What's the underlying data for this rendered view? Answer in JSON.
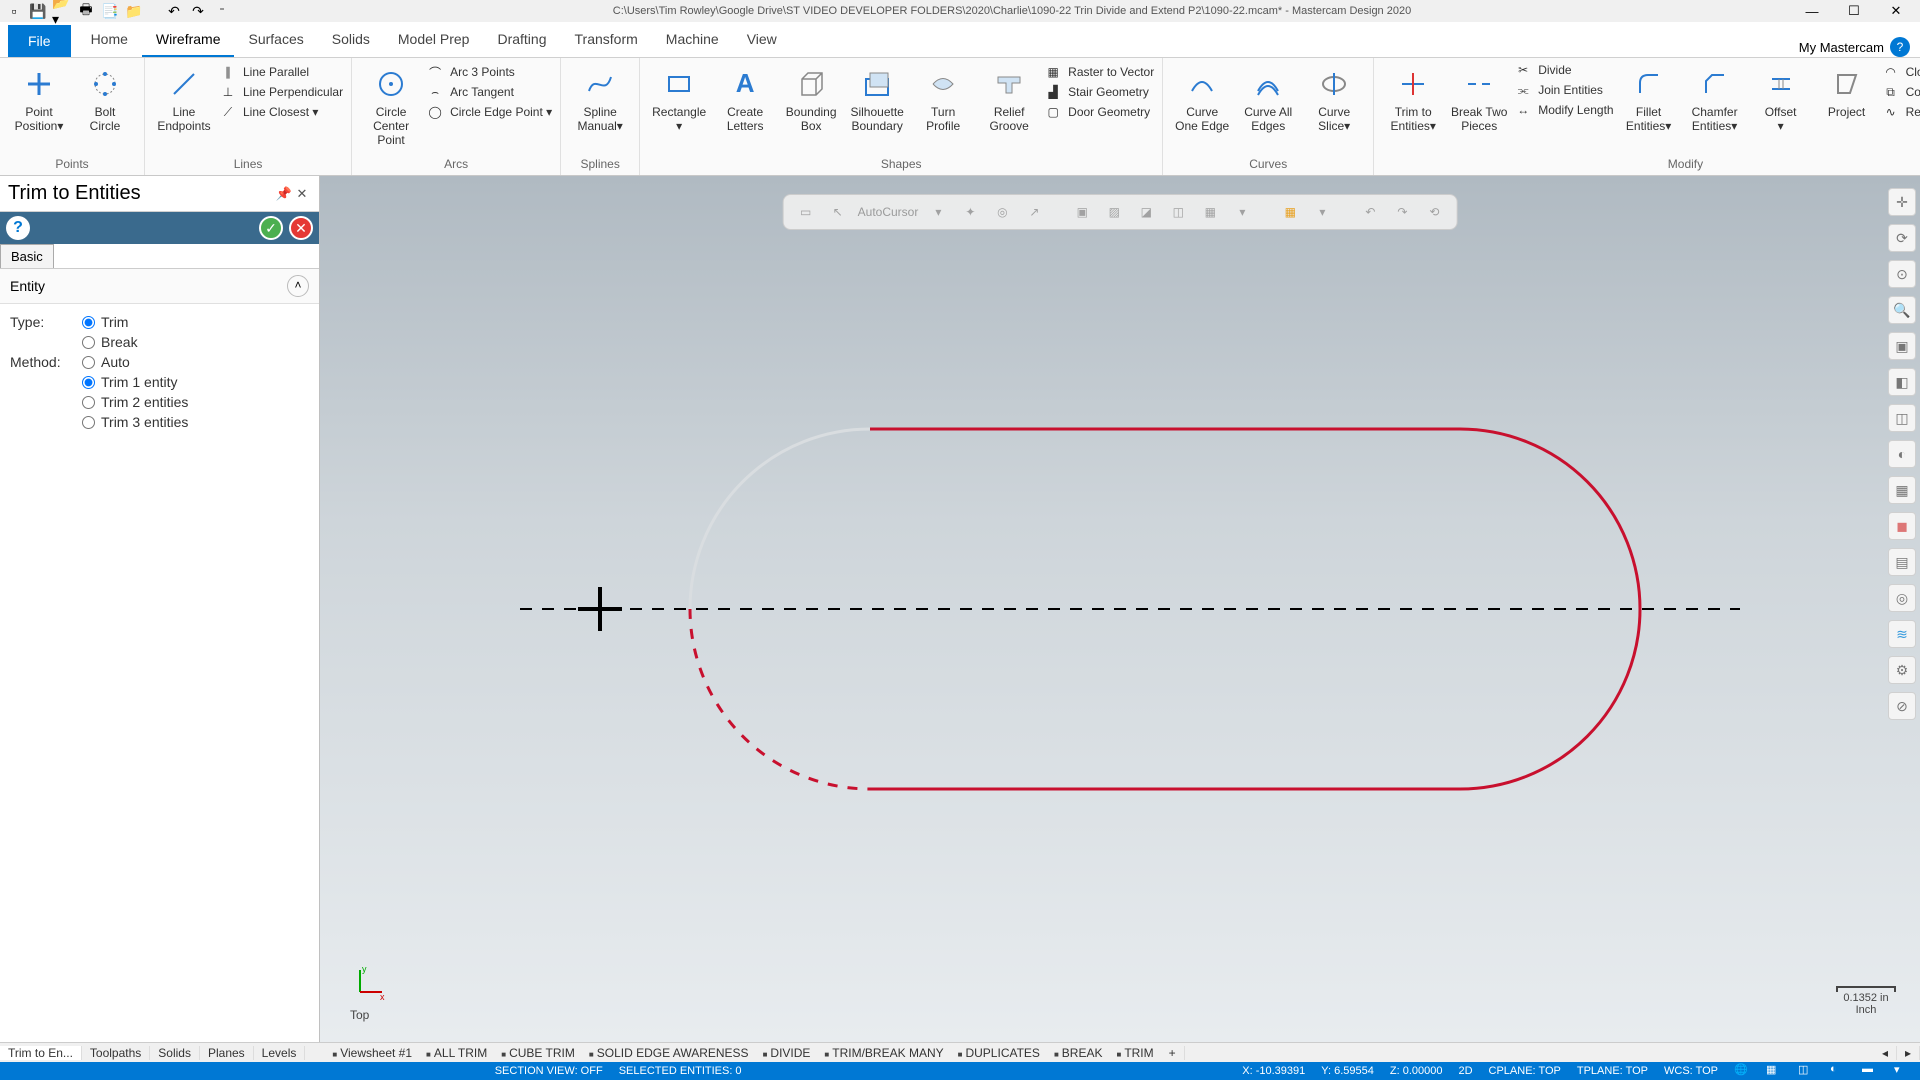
{
  "titlebar": {
    "path": "C:\\Users\\Tim Rowley\\Google Drive\\ST VIDEO DEVELOPER FOLDERS\\2020\\Charlie\\1090-22 Trin Divide and Extend P2\\1090-22.mcam* - Mastercam Design 2020"
  },
  "tabs": {
    "file": "File",
    "items": [
      "Home",
      "Wireframe",
      "Surfaces",
      "Solids",
      "Model Prep",
      "Drafting",
      "Transform",
      "Machine",
      "View"
    ],
    "active": "Wireframe",
    "right": "My Mastercam"
  },
  "ribbon": {
    "points": {
      "label": "Points",
      "btns": [
        [
          "Point",
          "Position▾"
        ],
        [
          "Bolt",
          "Circle"
        ]
      ]
    },
    "lines": {
      "label": "Lines",
      "big": [
        "Line",
        "Endpoints"
      ],
      "small": [
        "Line Parallel",
        "Line Perpendicular",
        "Line Closest ▾"
      ]
    },
    "arcs": {
      "label": "Arcs",
      "big": [
        "Circle",
        "Center Point"
      ],
      "small": [
        "Arc 3 Points",
        "Arc Tangent",
        "Circle Edge Point ▾"
      ]
    },
    "splines": {
      "label": "Splines",
      "big": [
        "Spline",
        "Manual▾"
      ]
    },
    "shapes": {
      "label": "Shapes",
      "big": [
        [
          "Rectangle"
        ],
        [
          "Create",
          "Letters"
        ],
        [
          "Bounding",
          "Box"
        ],
        [
          "Silhouette",
          "Boundary"
        ],
        [
          "Turn",
          "Profile"
        ],
        [
          "Relief",
          "Groove"
        ]
      ],
      "small": [
        "Raster to Vector",
        "Stair Geometry",
        "Door Geometry"
      ]
    },
    "curves": {
      "label": "Curves",
      "big": [
        [
          "Curve",
          "One Edge"
        ],
        [
          "Curve All",
          "Edges"
        ],
        [
          "Curve",
          "Slice▾"
        ]
      ]
    },
    "modify": {
      "label": "Modify",
      "big": [
        [
          "Trim to",
          "Entities▾"
        ],
        [
          "Break Two",
          "Pieces"
        ],
        [
          "Modify Length"
        ],
        [
          "Fillet",
          "Entities▾"
        ],
        [
          "Chamfer",
          "Entities▾"
        ],
        [
          "Offset",
          "▾"
        ],
        [
          "Project",
          ""
        ]
      ],
      "small1": [
        "Divide",
        "Join Entities"
      ],
      "small2": [
        "Close Arc ▾",
        "Combine Views",
        "Refit Spline ▾"
      ]
    }
  },
  "panel": {
    "title": "Trim to Entities",
    "basic": "Basic",
    "section": "Entity",
    "type_label": "Type:",
    "type_opts": [
      "Trim",
      "Break"
    ],
    "type_sel": "Trim",
    "method_label": "Method:",
    "method_opts": [
      "Auto",
      "Trim 1 entity",
      "Trim 2 entities",
      "Trim 3 entities"
    ],
    "method_sel": "Trim 1 entity"
  },
  "left_tabs": [
    "Trim to En...",
    "Toolpaths",
    "Solids",
    "Planes",
    "Levels"
  ],
  "bookmarks": [
    "Viewsheet #1",
    "ALL TRIM",
    "CUBE TRIM",
    "SOLID EDGE AWARENESS",
    "DIVIDE",
    "TRIM/BREAK MANY",
    "DUPLICATES",
    "BREAK",
    "TRIM"
  ],
  "overlay": {
    "autocursor": "AutoCursor"
  },
  "view": {
    "label": "Top",
    "scale": "0.1352 in\nInch"
  },
  "status": {
    "section": "SECTION VIEW: OFF",
    "selected": "SELECTED ENTITIES: 0",
    "x": "X: -10.39391",
    "y": "Y: 6.59554",
    "z": "Z: 0.00000",
    "mode": "2D",
    "cplane": "CPLANE: TOP",
    "tplane": "TPLANE: TOP",
    "wcs": "WCS: TOP"
  }
}
